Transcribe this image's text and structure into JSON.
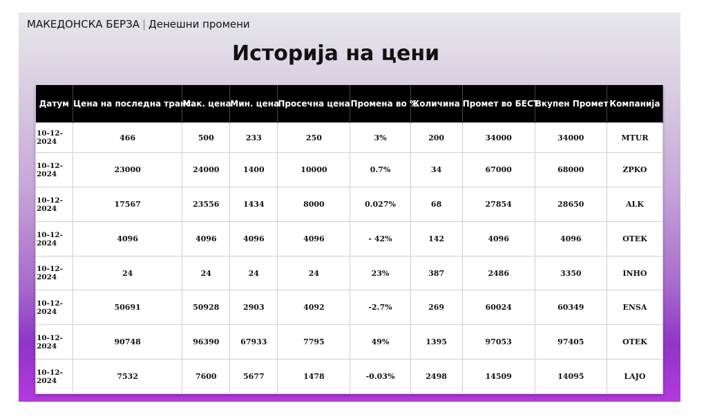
{
  "header": {
    "brand": "МАКЕДОНСКА БЕРЗА",
    "separator": "|",
    "subtitle": "Денешни промени"
  },
  "page_title": "Историја на цени",
  "table": {
    "columns": [
      "Датум",
      "Цена на последна транс.",
      "Мак. цена",
      "Мин. цена",
      "Просечна цена",
      "Промена во %",
      "Количина",
      "Промет во БЕСТ",
      "Вкупен Промет",
      "Компанија"
    ],
    "rows": [
      [
        "10-12-2024",
        "466",
        "500",
        "233",
        "250",
        "3%",
        "200",
        "34000",
        "34000",
        "MTUR"
      ],
      [
        "10-12-2024",
        "23000",
        "24000",
        "1400",
        "10000",
        "0.7%",
        "34",
        "67000",
        "68000",
        "ZPKO"
      ],
      [
        "10-12-2024",
        "17567",
        "23556",
        "1434",
        "8000",
        "0.027%",
        "68",
        "27854",
        "28650",
        "ALK"
      ],
      [
        "10-12-2024",
        "4096",
        "4096",
        "4096",
        "4096",
        "- 42%",
        "142",
        "4096",
        "4096",
        "OTEK"
      ],
      [
        "10-12-2024",
        "24",
        "24",
        "24",
        "24",
        "23%",
        "387",
        "2486",
        "3350",
        "INHO"
      ],
      [
        "10-12-2024",
        "50691",
        "50928",
        "2903",
        "4092",
        "-2.7%",
        "269",
        "60024",
        "60349",
        "ENSA"
      ],
      [
        "10-12-2024",
        "90748",
        "96390",
        "67933",
        "7795",
        "49%",
        "1395",
        "97053",
        "97405",
        "OTEK"
      ],
      [
        "10-12-2024",
        "7532",
        "7600",
        "5677",
        "1478",
        "-0.03%",
        "2498",
        "14509",
        "14095",
        "LAJO"
      ]
    ]
  }
}
